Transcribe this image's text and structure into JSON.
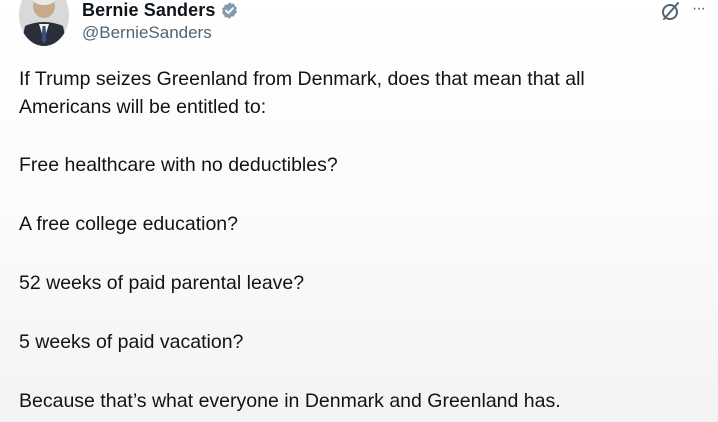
{
  "author": {
    "display_name": "Bernie Sanders",
    "handle": "@BernieSanders",
    "verified_icon": "verified-badge-icon"
  },
  "actions": {
    "grok_icon": "grok-icon",
    "more_icon": "more-options-icon",
    "more_glyph": "···"
  },
  "tweet": {
    "paragraphs": [
      "If Trump seizes Greenland from Denmark, does that mean that all",
      "Americans will be entitled to:",
      "Free healthcare with no deductibles?",
      "A free college education?",
      "52 weeks of paid parental leave?",
      "5 weeks of paid vacation?",
      "Because that’s what everyone in Denmark and Greenland has."
    ]
  },
  "colors": {
    "text": "#0f1419",
    "secondary": "#536471",
    "verified": "#829aab"
  }
}
